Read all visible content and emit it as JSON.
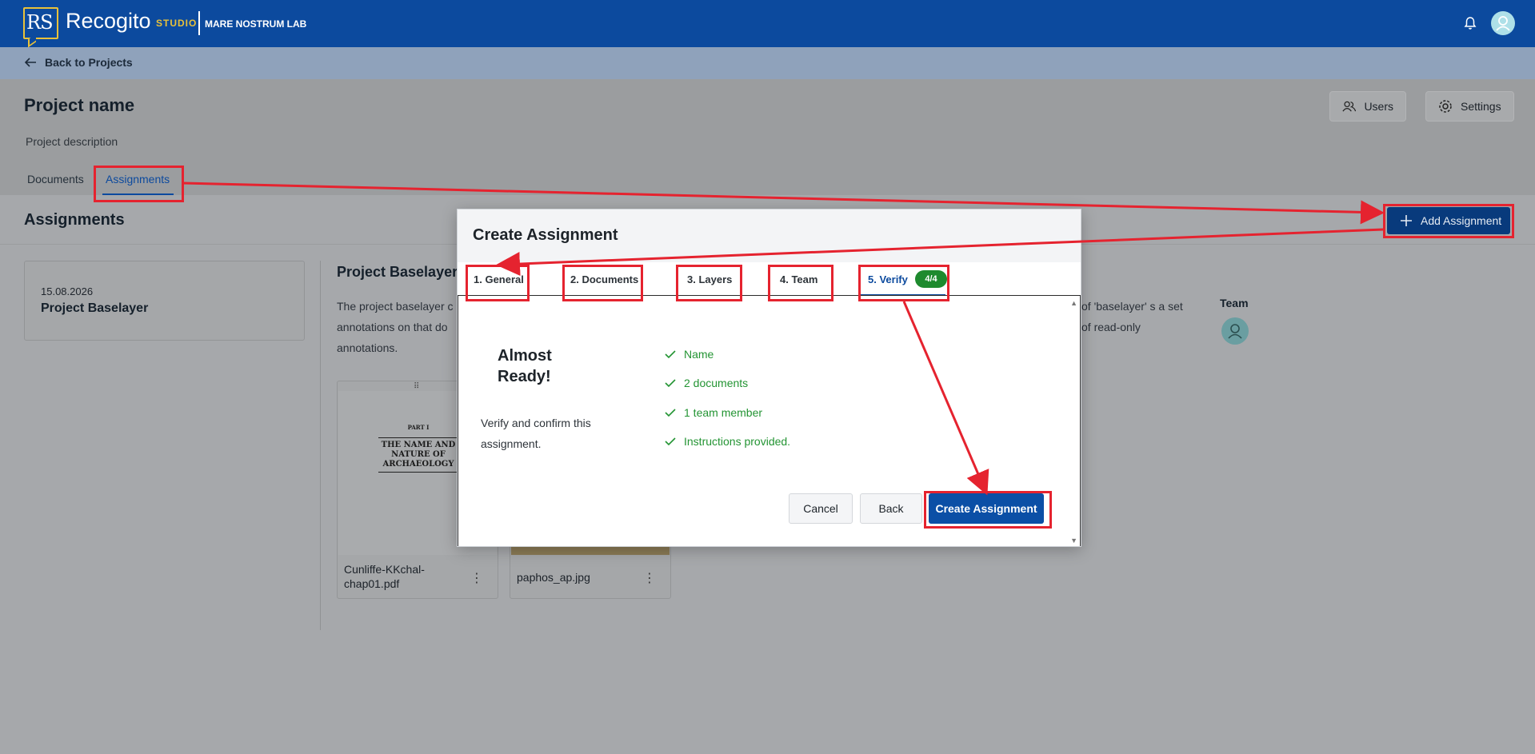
{
  "topbar": {
    "logo_text": "RS",
    "brand": "Recogito",
    "studio": "STUDIO",
    "org": "MARE NOSTRUM LAB",
    "icons": [
      "bell-icon",
      "user-avatar-icon"
    ]
  },
  "nav": {
    "back_label": "Back to Projects"
  },
  "project": {
    "title": "Project name",
    "description": "Project description",
    "users_label": "Users",
    "settings_label": "Settings"
  },
  "tabs": [
    {
      "label": "Documents",
      "active": false
    },
    {
      "label": "Assignments",
      "active": true
    }
  ],
  "assignments": {
    "title": "Assignments",
    "add_label": "Add Assignment",
    "card": {
      "date": "15.08.2026",
      "name": "Project Baselayer"
    },
    "detail_title": "Project Baselayer",
    "detail_text_left": "The project baselayer c annotations on that do annotations.",
    "detail_text_right": "of 'baselayer' s a set of read-only",
    "team_label": "Team",
    "documents": [
      {
        "name": "Cunliffe-KKchal-chap01.pdf",
        "cover_lines": [
          "PART I",
          "THE NAME AND",
          "NATURE OF",
          "ARCHAEOLOGY"
        ]
      },
      {
        "name": "paphos_ap.jpg"
      }
    ]
  },
  "modal": {
    "title": "Create Assignment",
    "steps": [
      {
        "label": "1. General"
      },
      {
        "label": "2. Documents"
      },
      {
        "label": "3. Layers"
      },
      {
        "label": "4. Team"
      },
      {
        "label": "5. Verify",
        "badge": "4/4",
        "active": true
      }
    ],
    "heading": "Almost Ready!",
    "subtext": "Verify and confirm this assignment.",
    "checks": [
      "Name",
      "2 documents",
      "1 team member",
      "Instructions provided."
    ],
    "cancel_label": "Cancel",
    "back_label": "Back",
    "create_label": "Create Assignment"
  },
  "colors": {
    "brand_blue": "#0c4a9e",
    "accent_yellow": "#e9c13a",
    "success_green": "#239433",
    "annotation_red": "#e5232f"
  }
}
